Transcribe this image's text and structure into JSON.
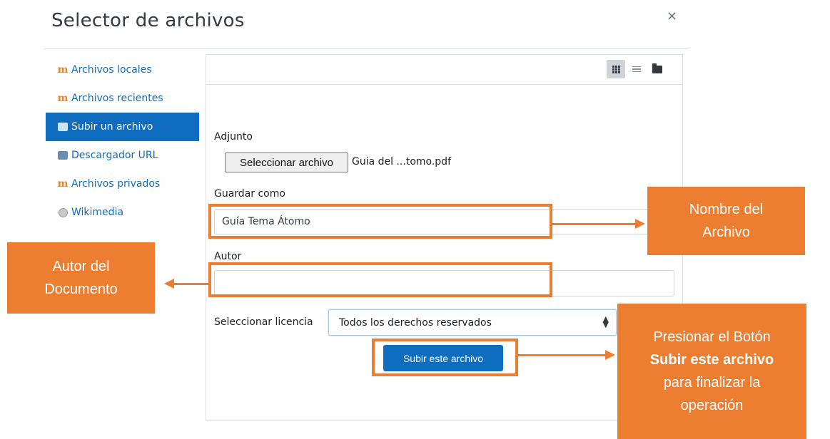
{
  "dialog": {
    "title": "Selector de archivos",
    "close": "×"
  },
  "sidebar": {
    "items": [
      {
        "label": "Archivos locales",
        "icon": "moodle-icon"
      },
      {
        "label": "Archivos recientes",
        "icon": "moodle-icon"
      },
      {
        "label": "Subir un archivo",
        "icon": "upload-icon",
        "active": true
      },
      {
        "label": "Descargador URL",
        "icon": "url-download-icon"
      },
      {
        "label": "Archivos privados",
        "icon": "moodle-icon"
      },
      {
        "label": "Wikimedia",
        "icon": "wikimedia-icon"
      }
    ]
  },
  "toolbar": {
    "views": [
      "icons-view",
      "list-view",
      "tree-view"
    ],
    "active_view": "icons-view"
  },
  "form": {
    "attachment_label": "Adjunto",
    "choose_file_button": "Seleccionar archivo",
    "chosen_file": "Guia del ...tomo.pdf",
    "save_as_label": "Guardar como",
    "save_as_value": "Guía Tema Átomo",
    "author_label": "Autor",
    "author_value": "",
    "license_label": "Seleccionar licencia",
    "license_value": "Todos los derechos reservados",
    "submit_button": "Subir este archivo"
  },
  "annotations": {
    "file_name": {
      "line1": "Nombre del",
      "line2": "Archivo"
    },
    "author": {
      "line1": "Autor del",
      "line2": "Documento"
    },
    "submit": {
      "line1": "Presionar el Botón",
      "line2": "Subir este archivo",
      "line3": "para finalizar la",
      "line4": "operación"
    }
  },
  "colors": {
    "accent": "#0f6cbf",
    "annotation": "#ed7d31",
    "moodle_icon": "#f98012"
  }
}
